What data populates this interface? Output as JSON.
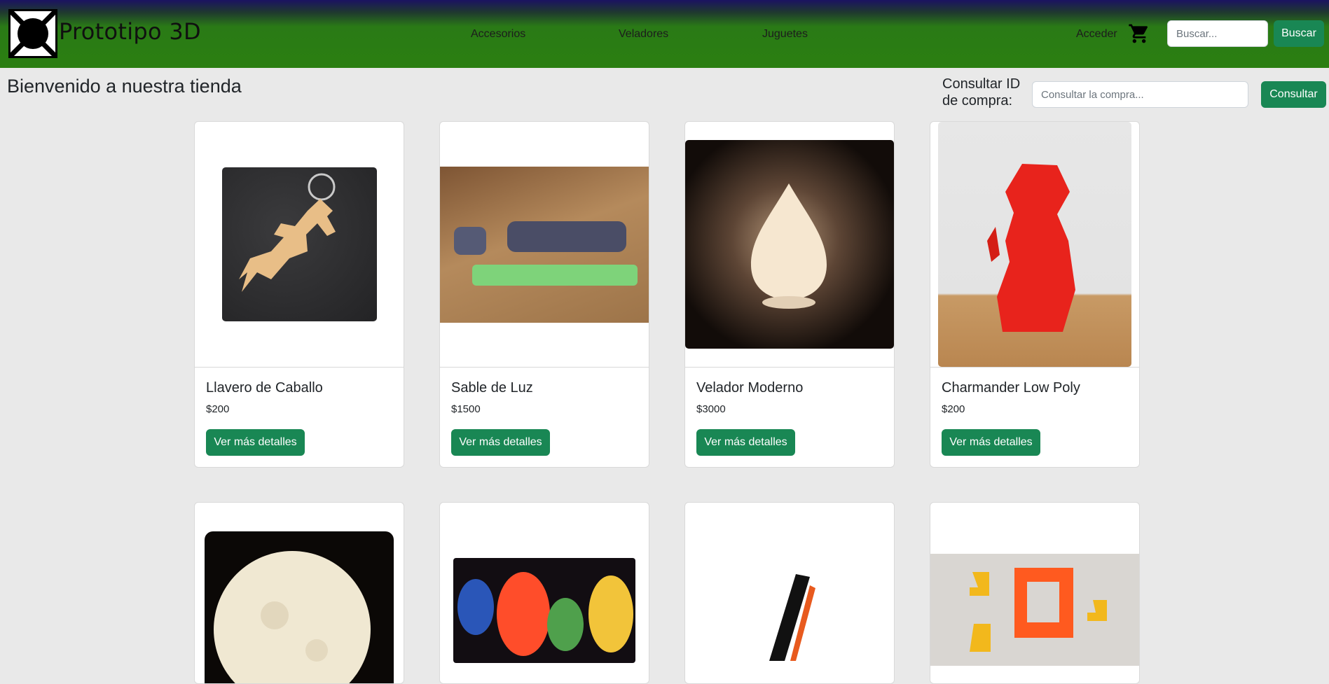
{
  "navbar": {
    "brand": "Prototipo 3D",
    "links": [
      "Accesorios",
      "Veladores",
      "Juguetes"
    ],
    "login": "Acceder",
    "search_placeholder": "Buscar...",
    "search_button": "Buscar"
  },
  "header": {
    "welcome": "Bienvenido a nuestra tienda",
    "consult_label_line1": "Consultar ID",
    "consult_label_line2": "de compra:",
    "consult_placeholder": "Consultar la compra...",
    "consult_button": "Consultar"
  },
  "products": [
    {
      "name": "Llavero de Caballo",
      "price": "$200",
      "button": "Ver más detalles",
      "icon": "horse-keychain-photo"
    },
    {
      "name": "Sable de Luz",
      "price": "$1500",
      "button": "Ver más detalles",
      "icon": "lightsaber-photo"
    },
    {
      "name": "Velador Moderno",
      "price": "$3000",
      "button": "Ver más detalles",
      "icon": "drop-lamp-photo"
    },
    {
      "name": "Charmander Low Poly",
      "price": "$200",
      "button": "Ver más detalles",
      "icon": "charmander-photo"
    },
    {
      "icon": "moon-lamp-photo"
    },
    {
      "icon": "pokemon-lamps-photo"
    },
    {
      "icon": "phone-stand-photo"
    },
    {
      "icon": "cube-puzzle-photo"
    }
  ],
  "colors": {
    "nav_green": "#2b7f11",
    "nav_top": "#1b1361",
    "button_green": "#198754",
    "page_bg": "#e9e9e9"
  }
}
